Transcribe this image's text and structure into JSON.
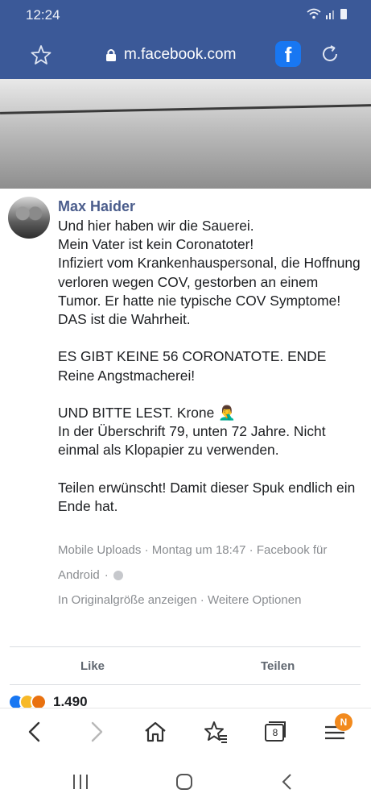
{
  "status_bar": {
    "time": "12:24"
  },
  "browser": {
    "url": "m.facebook.com",
    "tab_count": "8",
    "menu_badge": "N"
  },
  "post": {
    "author": "Max Haider",
    "body": "Und hier haben wir die Sauerei.\nMein Vater ist kein Coronatoter!\nInfiziert vom Krankenhauspersonal, die Hoffnung verloren wegen COV, gestorben an einem Tumor. Er hatte nie typische COV Symptome!\nDAS ist die Wahrheit.\n\nES GIBT KEINE 56 CORONATOTE. ENDE\nReine Angstmacherei!\n\nUND BITTE LEST. Krone 🤦‍♂️\nIn der Überschrift 79, unten 72 Jahre. Nicht einmal als Klopapier zu verwenden.\n\nTeilen erwünscht! Damit dieser Spuk endlich ein Ende hat.",
    "album": "Mobile Uploads",
    "timestamp": "Montag um 18:47",
    "app_prefix": "Facebook für",
    "app_suffix": "Android",
    "sep": "·",
    "full_size_link": "In Originalgröße anzeigen",
    "more_options_link": "Weitere Optionen",
    "like_label": "Like",
    "share_label": "Teilen",
    "reactions_count": "1.490"
  },
  "colors": {
    "brand_blue": "#3b5998",
    "facebook_blue": "#1877f2",
    "author_blue": "#4b5d8c",
    "meta_gray": "#8a8d91"
  },
  "icons": {
    "toolbar": [
      "back-icon",
      "forward-icon",
      "home-icon",
      "bookmarks-icon",
      "tabs-icon",
      "menu-icon"
    ],
    "navbar": [
      "recent-apps-icon",
      "home-nav-icon",
      "back-nav-icon"
    ]
  }
}
